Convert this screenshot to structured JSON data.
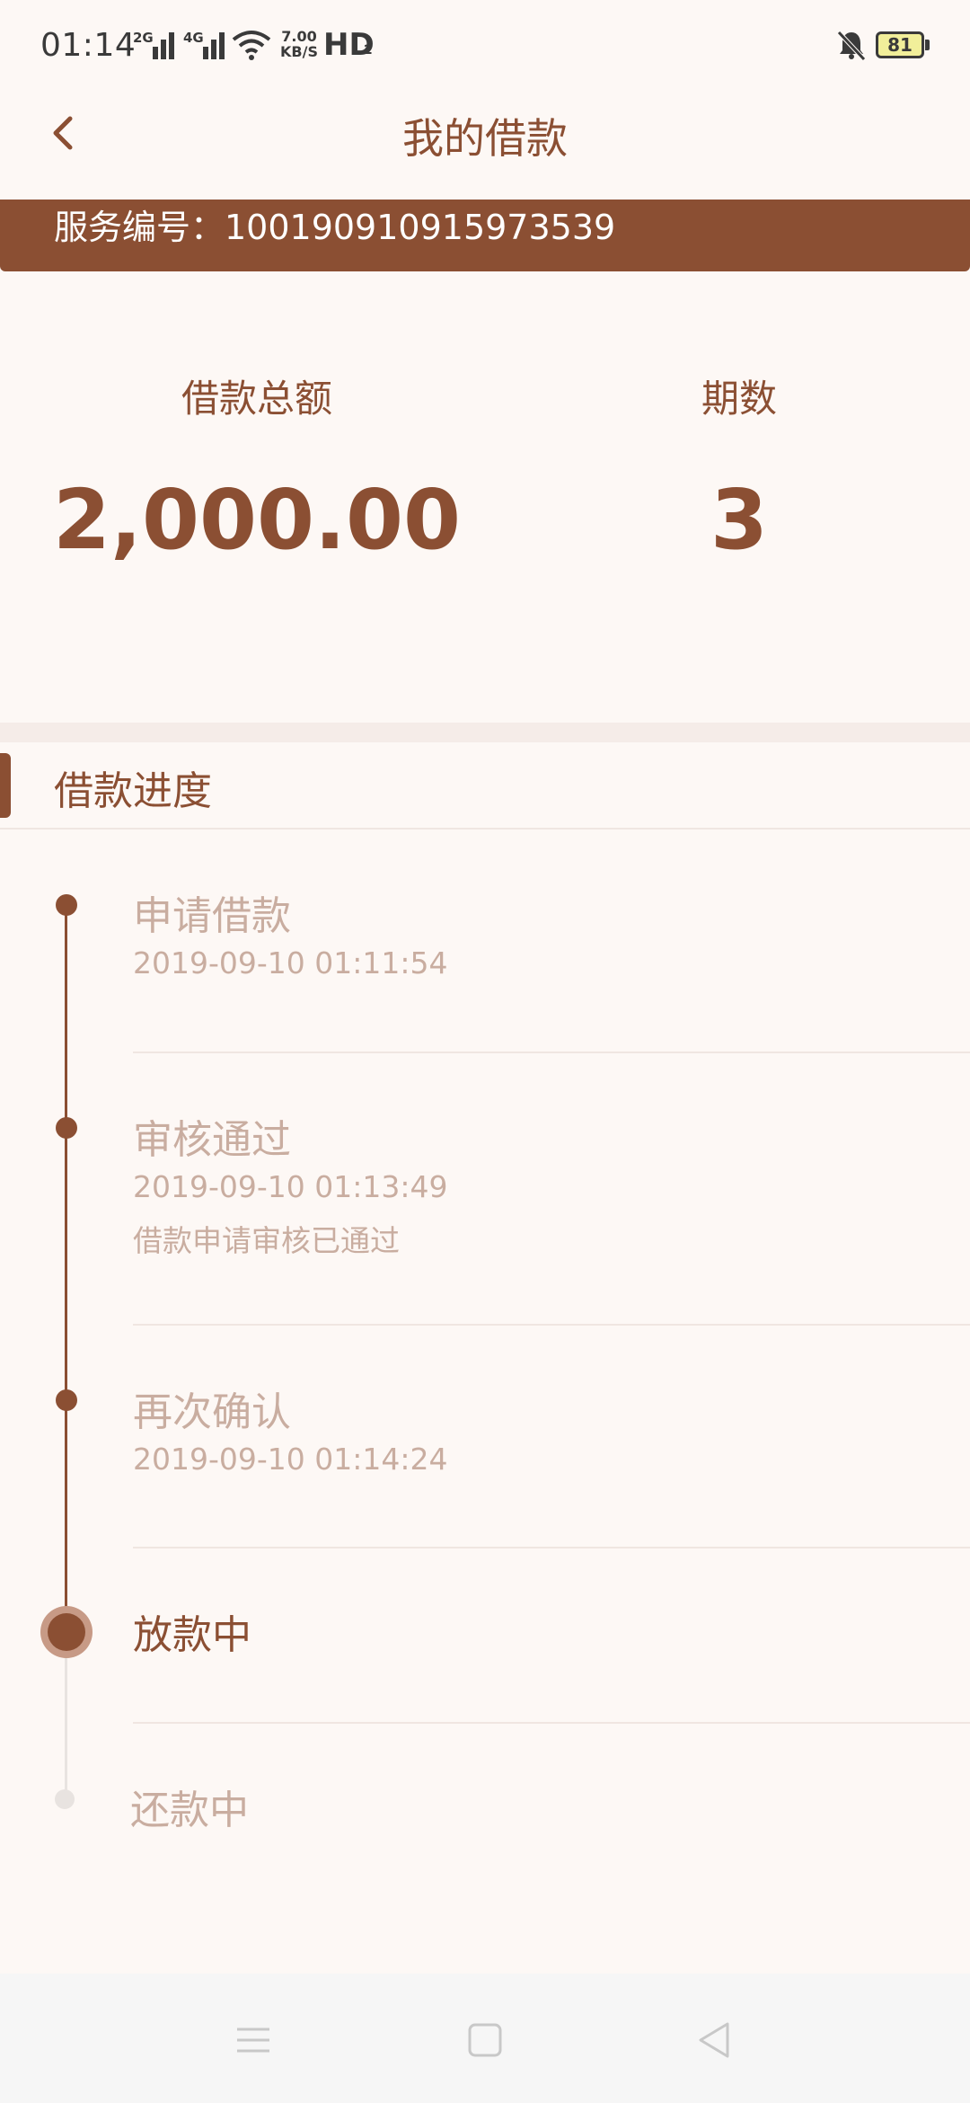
{
  "status_bar": {
    "time": "01:14",
    "signal1_label": "2G",
    "signal2_label": "4G",
    "speed_value": "7.00",
    "speed_unit": "KB/S",
    "hd": "HD",
    "hd_sub": "2",
    "battery": "81"
  },
  "header": {
    "title": "我的借款"
  },
  "banner": {
    "service_text": "服务编号：100190910915973539"
  },
  "summary": {
    "amount_label": "借款总额",
    "amount_value": "2,000.00",
    "periods_label": "期数",
    "periods_value": "3"
  },
  "progress": {
    "section_title": "借款进度",
    "steps": [
      {
        "title": "申请借款",
        "time": "2019-09-10 01:11:54",
        "note": ""
      },
      {
        "title": "审核通过",
        "time": "2019-09-10 01:13:49",
        "note": "借款申请审核已通过"
      },
      {
        "title": "再次确认",
        "time": "2019-09-10 01:14:24",
        "note": ""
      },
      {
        "title": "放款中",
        "time": "",
        "note": ""
      },
      {
        "title": "还款中",
        "time": "",
        "note": ""
      }
    ]
  },
  "colors": {
    "brand": "#8b4f33",
    "muted_text": "#c9ada0",
    "background": "#fdf8f5"
  },
  "icons": {
    "back": "chevron-left-icon",
    "nav_menu": "menu-icon",
    "nav_home": "square-icon",
    "nav_back": "triangle-back-icon"
  }
}
